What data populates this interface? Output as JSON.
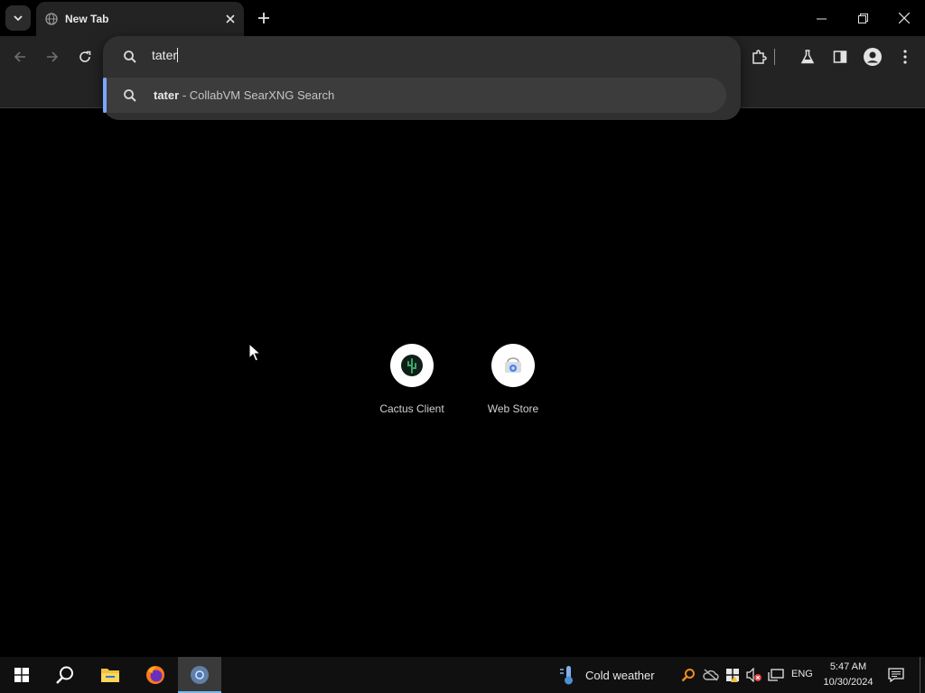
{
  "tab": {
    "title": "New Tab"
  },
  "omnibox": {
    "value": "tater",
    "suggestion": {
      "query": "tater",
      "separator": "-",
      "engine": "CollabVM SearXNG Search"
    }
  },
  "shortcuts": [
    {
      "label": "Cactus Client",
      "icon": "cactus-client-icon"
    },
    {
      "label": "Web Store",
      "icon": "web-store-icon"
    }
  ],
  "taskbar": {
    "weather": "Cold weather",
    "lang": "ENG",
    "time": "5:47 AM",
    "date": "10/30/2024"
  },
  "colors": {
    "accent_blue": "#7ca7ff",
    "toolbar_bg": "#232323",
    "popup_bg": "#303030",
    "taskbar_bg": "#101010",
    "active_task_line": "#76b9ed"
  }
}
